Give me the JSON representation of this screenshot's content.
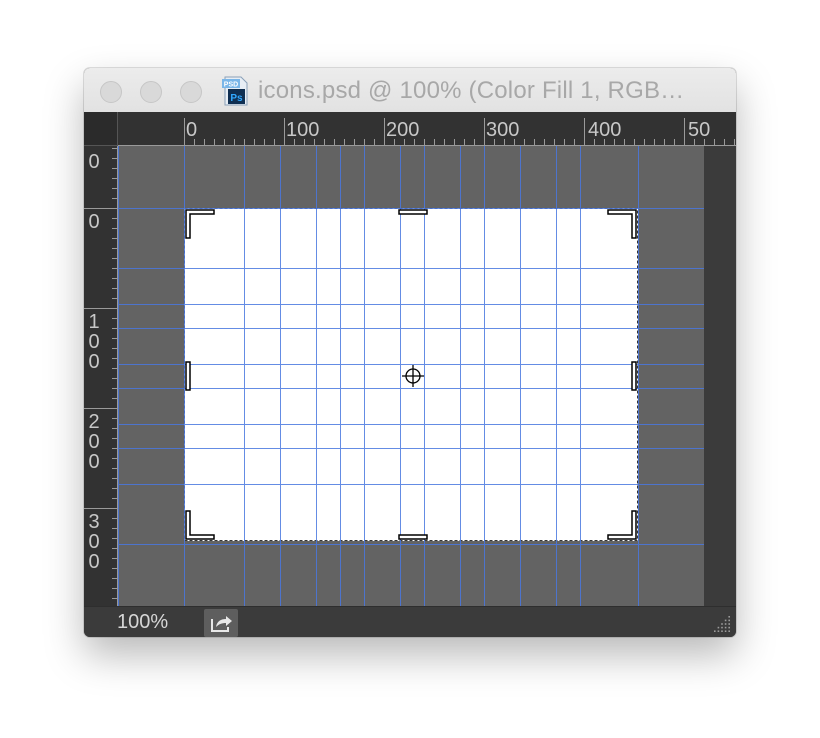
{
  "window": {
    "title": "icons.psd @ 100% (Color Fill 1, RGB…",
    "file_icon_label": "PSD",
    "app_badge": "Ps"
  },
  "rulers": {
    "horizontal_ticks": [
      "0",
      "100",
      "200",
      "300",
      "400",
      "50"
    ],
    "vertical_ticks": [
      "0",
      "0",
      "100",
      "200",
      "300"
    ]
  },
  "status": {
    "zoom": "100%"
  },
  "colors": {
    "canvas_background": "#636363",
    "document": "#ffffff",
    "guides": "#4a78e0",
    "chrome": "#323232"
  },
  "icons": [
    "photoshop-file-icon",
    "export-icon",
    "resize-grip-icon",
    "crosshair-icon"
  ]
}
